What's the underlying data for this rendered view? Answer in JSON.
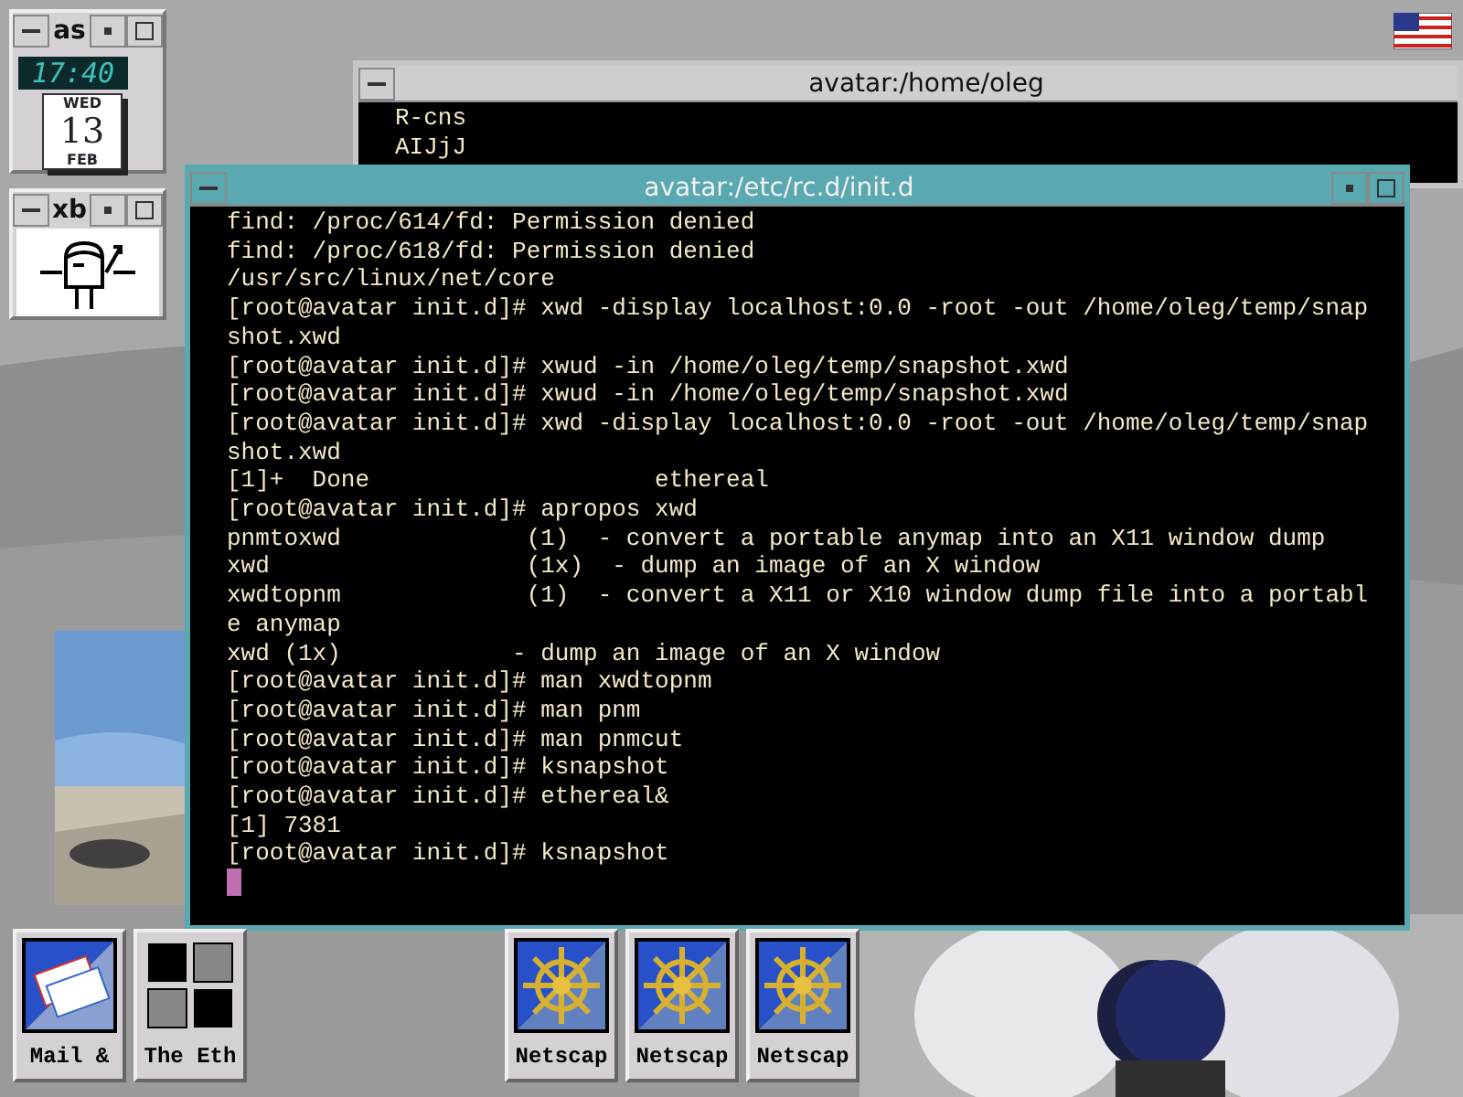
{
  "applets": [
    {
      "kind": "clock",
      "title": "as",
      "time": "17:40",
      "weekday": "WED",
      "day": "13",
      "month": "FEB"
    },
    {
      "kind": "mail",
      "title": "xb"
    }
  ],
  "windows": [
    {
      "title": "avatar:/home/oleg",
      "focused": false,
      "lines": [
        "R-cns",
        "AIJjJ"
      ]
    },
    {
      "title": "avatar:/etc/rc.d/init.d",
      "focused": true,
      "cursor": true,
      "lines": [
        "find: /proc/614/fd: Permission denied",
        "find: /proc/618/fd: Permission denied",
        "/usr/src/linux/net/core",
        "[root@avatar init.d]# xwd -display localhost:0.0 -root -out /home/oleg/temp/snap",
        "shot.xwd",
        "[root@avatar init.d]# xwud -in /home/oleg/temp/snapshot.xwd",
        "[root@avatar init.d]# xwud -in /home/oleg/temp/snapshot.xwd",
        "[root@avatar init.d]# xwd -display localhost:0.0 -root -out /home/oleg/temp/snap",
        "shot.xwd",
        "[1]+  Done                    ethereal",
        "[root@avatar init.d]# apropos xwd",
        "pnmtoxwd             (1)  - convert a portable anymap into an X11 window dump",
        "xwd                  (1x)  - dump an image of an X window",
        "xwdtopnm             (1)  - convert a X11 or X10 window dump file into a portabl",
        "e anymap",
        "xwd (1x)            - dump an image of an X window",
        "[root@avatar init.d]# man xwdtopnm",
        "[root@avatar init.d]# man pnm",
        "[root@avatar init.d]# man pnmcut",
        "[root@avatar init.d]# ksnapshot",
        "[root@avatar init.d]# ethereal&",
        "[1] 7381",
        "[root@avatar init.d]# ksnapshot"
      ]
    }
  ],
  "dock": [
    {
      "kind": "mail",
      "label": "Mail &"
    },
    {
      "kind": "grid",
      "label": "The Eth"
    },
    {
      "kind": "wheel",
      "label": "Netscap"
    },
    {
      "kind": "wheel",
      "label": "Netscap"
    },
    {
      "kind": "wheel",
      "label": "Netscap"
    }
  ]
}
